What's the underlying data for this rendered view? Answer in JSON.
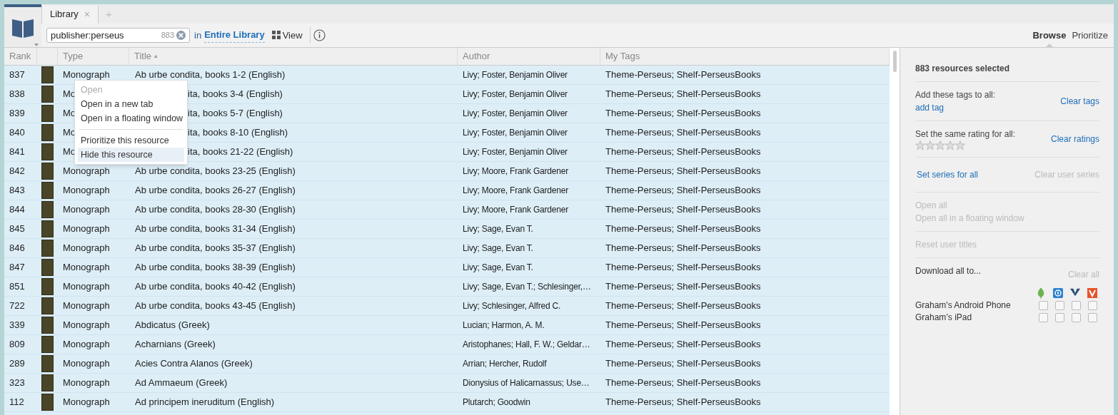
{
  "tabs": [
    {
      "label": "Library",
      "close": "×",
      "selected": true
    },
    {
      "label": "+",
      "selected": false
    }
  ],
  "search": {
    "value": "publisher:perseus",
    "count": "883"
  },
  "scope": {
    "prefix": "in",
    "label": "Entire Library"
  },
  "view_button": "View",
  "modes": [
    {
      "label": "Browse",
      "selected": true
    },
    {
      "label": "Prioritize",
      "selected": false
    }
  ],
  "table": {
    "columns": [
      {
        "label": "Rank"
      },
      {},
      {
        "label": "Type"
      },
      {
        "label": "Title",
        "sort": "▴"
      },
      {
        "label": "Author"
      },
      {
        "label": "My Tags"
      }
    ],
    "rows": [
      {
        "rank": "837",
        "type": "Monograph",
        "title": "Ab urbe condita, books 1-2 (English)",
        "author": "Livy; Foster, Benjamin Oliver",
        "tags": "Theme-Perseus; Shelf-PerseusBooks"
      },
      {
        "rank": "838",
        "type": "Mo",
        "title": "ita, books 3-4 (English)",
        "author": "Livy; Foster, Benjamin Oliver",
        "tags": "Theme-Perseus; Shelf-PerseusBooks",
        "covered": true
      },
      {
        "rank": "839",
        "type": "Mo",
        "title": "ita, books 5-7 (English)",
        "author": "Livy; Foster, Benjamin Oliver",
        "tags": "Theme-Perseus; Shelf-PerseusBooks",
        "covered": true
      },
      {
        "rank": "840",
        "type": "Mo",
        "title": "ita, books 8-10 (English)",
        "author": "Livy; Foster, Benjamin Oliver",
        "tags": "Theme-Perseus; Shelf-PerseusBooks",
        "covered": true
      },
      {
        "rank": "841",
        "type": "Mo",
        "title": "ita, books 21-22 (English)",
        "author": "Livy; Foster, Benjamin Oliver",
        "tags": "Theme-Perseus; Shelf-PerseusBooks",
        "covered": true
      },
      {
        "rank": "842",
        "type": "Monograph",
        "title": "Ab urbe condita, books 23-25 (English)",
        "author": "Livy; Moore, Frank Gardener",
        "tags": "Theme-Perseus; Shelf-PerseusBooks"
      },
      {
        "rank": "843",
        "type": "Monograph",
        "title": "Ab urbe condita, books 26-27 (English)",
        "author": "Livy; Moore, Frank Gardener",
        "tags": "Theme-Perseus; Shelf-PerseusBooks"
      },
      {
        "rank": "844",
        "type": "Monograph",
        "title": "Ab urbe condita, books 28-30 (English)",
        "author": "Livy; Moore, Frank Gardener",
        "tags": "Theme-Perseus; Shelf-PerseusBooks"
      },
      {
        "rank": "845",
        "type": "Monograph",
        "title": "Ab urbe condita, books 31-34 (English)",
        "author": "Livy; Sage, Evan T.",
        "tags": "Theme-Perseus; Shelf-PerseusBooks"
      },
      {
        "rank": "846",
        "type": "Monograph",
        "title": "Ab urbe condita, books 35-37 (English)",
        "author": "Livy; Sage, Evan T.",
        "tags": "Theme-Perseus; Shelf-PerseusBooks"
      },
      {
        "rank": "847",
        "type": "Monograph",
        "title": "Ab urbe condita, books 38-39 (English)",
        "author": "Livy; Sage, Evan T.",
        "tags": "Theme-Perseus; Shelf-PerseusBooks"
      },
      {
        "rank": "851",
        "type": "Monograph",
        "title": "Ab urbe condita, books 40-42 (English)",
        "author": "Livy; Sage, Evan T.; Schlesinger,…",
        "tags": "Theme-Perseus; Shelf-PerseusBooks"
      },
      {
        "rank": "722",
        "type": "Monograph",
        "title": "Ab urbe condita, books 43-45 (English)",
        "author": "Livy; Schlesinger, Alfred C.",
        "tags": "Theme-Perseus; Shelf-PerseusBooks"
      },
      {
        "rank": "339",
        "type": "Monograph",
        "title": "Abdicatus (Greek)",
        "author": "Lucian; Harmon, A. M.",
        "tags": "Theme-Perseus; Shelf-PerseusBooks"
      },
      {
        "rank": "809",
        "type": "Monograph",
        "title": "Acharnians (Greek)",
        "author": "Aristophanes; Hall, F. W.; Geldar…",
        "tags": "Theme-Perseus; Shelf-PerseusBooks"
      },
      {
        "rank": "289",
        "type": "Monograph",
        "title": "Acies Contra Alanos (Greek)",
        "author": "Arrian; Hercher, Rudolf",
        "tags": "Theme-Perseus; Shelf-PerseusBooks"
      },
      {
        "rank": "323",
        "type": "Monograph",
        "title": "Ad Ammaeum (Greek)",
        "author": "Dionysius of Halicarnassus; Use…",
        "tags": "Theme-Perseus; Shelf-PerseusBooks"
      },
      {
        "rank": "112",
        "type": "Monograph",
        "title": "Ad principem ineruditum (English)",
        "author": "Plutarch; Goodwin",
        "tags": "Theme-Perseus; Shelf-PerseusBooks"
      }
    ]
  },
  "context_menu": [
    {
      "label": "Open",
      "disabled": true,
      "hover": false
    },
    {
      "label": "Open in a new tab",
      "disabled": false,
      "hover": false
    },
    {
      "label": "Open in a floating window",
      "disabled": false,
      "hover": false
    },
    {
      "kind": "separator"
    },
    {
      "label": "Prioritize this resource",
      "disabled": false,
      "hover": false
    },
    {
      "label": "Hide this resource",
      "disabled": false,
      "hover": true
    }
  ],
  "panel": {
    "heading": "883 resources selected",
    "tags": {
      "label": "Add these tags to all:",
      "link": "add tag",
      "clear": "Clear tags"
    },
    "rating": {
      "label": "Set the same rating for all:",
      "stars": 0,
      "clear": "Clear ratings"
    },
    "series": {
      "link": "Set series for all",
      "clear": "Clear user series",
      "clear_disabled": true
    },
    "open": [
      {
        "label": "Open all",
        "disabled": true
      },
      {
        "label": "Open all in a floating window",
        "disabled": true
      }
    ],
    "reset": {
      "label": "Reset user titles",
      "disabled": true
    },
    "download": {
      "label": "Download all to...",
      "clear": "Clear all",
      "apps": [
        {
          "kind": "leaf"
        },
        {
          "kind": "circle"
        },
        {
          "kind": "vee"
        },
        {
          "kind": "orange"
        }
      ],
      "devices": [
        {
          "name": "Graham's Android Phone",
          "checks": [
            false,
            false,
            false,
            false
          ]
        },
        {
          "name": "Graham’s iPad",
          "checks": [
            false,
            false,
            false,
            false
          ]
        }
      ]
    }
  }
}
